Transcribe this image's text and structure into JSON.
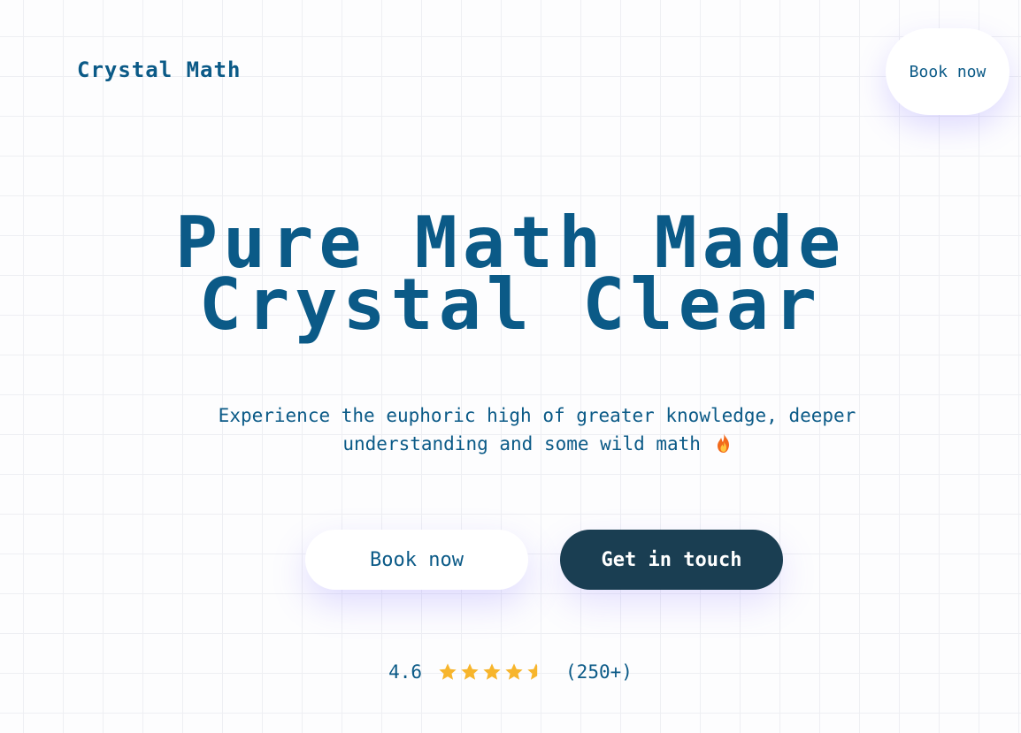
{
  "header": {
    "logo": "Crystal Math",
    "book_label": "Book now"
  },
  "hero": {
    "title_line1": "Pure Math Made",
    "title_line2": "Crystal Clear",
    "subtitle": "Experience the euphoric high of greater knowledge, deeper understanding and some wild math",
    "subtitle_icon": "fire-icon"
  },
  "actions": {
    "book_label": "Book now",
    "contact_label": "Get in touch"
  },
  "rating": {
    "score": "4.6",
    "value": 4.6,
    "max": 5,
    "count": "(250+)",
    "star_color": "#f7b52c"
  },
  "colors": {
    "primary": "#0b5a87",
    "dark_button": "#1a3e52",
    "background": "#fdfdfe"
  }
}
